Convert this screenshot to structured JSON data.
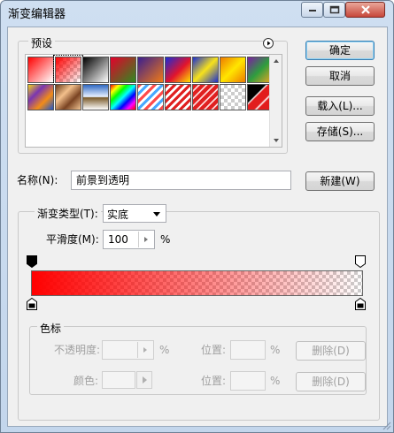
{
  "window": {
    "title": "渐变编辑器"
  },
  "presets": {
    "label": "预设",
    "swatches": [
      {
        "name": "foreground-to-background",
        "bg": "linear-gradient(135deg,#ff0000 0%,#ffffff 100%)"
      },
      {
        "name": "foreground-to-transparent",
        "bg": "linear-gradient(135deg,#ff0000 0%,rgba(255,0,0,0) 100%)"
      },
      {
        "name": "black-white",
        "bg": "linear-gradient(135deg,#000 0%,#fff 100%)"
      },
      {
        "name": "red-green",
        "bg": "linear-gradient(135deg,#e4002b 0%,#2e8b20 100%)"
      },
      {
        "name": "violet-orange",
        "bg": "linear-gradient(135deg,#3a1f8f 0%,#f07a16 100%)"
      },
      {
        "name": "blue-red-yellow",
        "bg": "linear-gradient(135deg,#1a2bd6 0%,#e2142c 55%,#ffe400 100%)"
      },
      {
        "name": "blue-yellow-blue",
        "bg": "linear-gradient(135deg,#1b2fd0 0%,#f7e21b 50%,#1b2fd0 100%)"
      },
      {
        "name": "orange-yellow-orange",
        "bg": "linear-gradient(135deg,#ee7b00 0%,#ffe600 50%,#ee7b00 100%)"
      },
      {
        "name": "violet-green-orange",
        "bg": "linear-gradient(135deg,#7b1fa2 0%,#2e9d3e 50%,#f5a623 100%)"
      },
      {
        "name": "yellow-violet-orange-blue",
        "bg": "linear-gradient(135deg,#f4d21a 0%,#7a36b1 33%,#f28c18 66%,#1f55c9 100%)"
      },
      {
        "name": "copper",
        "bg": "linear-gradient(135deg,#6b3a18 0%,#f3c08c 35%,#7a4322 65%,#f0c493 100%)"
      },
      {
        "name": "chrome",
        "bg": "linear-gradient(180deg,#2f69c2 0%,#e9f1ff 48%,#7a5a2a 52%,#ffffff 100%)"
      },
      {
        "name": "spectrum",
        "bg": "linear-gradient(135deg,#ff0000 0%,#ffff00 17%,#00ff00 33%,#00ffff 50%,#0000ff 67%,#ff00ff 83%,#ff0000 100%)"
      },
      {
        "name": "transparent-rainbow",
        "bg": "repeating-linear-gradient(135deg,#ff4a4a 0 3px,#ffffff 3px 6px,#49a9ff 6px 9px,#ffffff 9px 12px)"
      },
      {
        "name": "transparent-stripes-red",
        "bg": "repeating-linear-gradient(135deg,#e02020 0 3px,#ffffff 3px 6px)"
      },
      {
        "name": "transparent-stripes-red-2",
        "bg": "repeating-linear-gradient(135deg,#e02020 0 4px,#ffd6d6 4px 6px)"
      },
      {
        "name": "checker-transparent",
        "bg": "checker"
      },
      {
        "name": "black-red-stripes",
        "bg": "linear-gradient(135deg,#000 0%,#000 35%,#fff 38%,#e21c1c 42%,#e21c1c 62%,#fff 66%,#e21c1c 70%,#e21c1c 100%)"
      }
    ],
    "selected_index": 1,
    "menu_icon": "triangle-right-circle-icon"
  },
  "buttons": {
    "ok": "确定",
    "cancel": "取消",
    "load": "载入(L)...",
    "save": "存储(S)...",
    "new": "新建(W)"
  },
  "name_field": {
    "label": "名称(N):",
    "value": "前景到透明"
  },
  "gradient": {
    "type_label": "渐变类型(T):",
    "type_value": "实底",
    "smoothness_label": "平滑度(M):",
    "smoothness_value": "100",
    "smoothness_unit": "%",
    "color": "#ff0000"
  },
  "stops_panel": {
    "label": "色标",
    "opacity_label": "不透明度:",
    "opacity_unit": "%",
    "location_label": "位置:",
    "location_unit": "%",
    "delete_label": "删除(D)",
    "color_label": "颜色:"
  }
}
